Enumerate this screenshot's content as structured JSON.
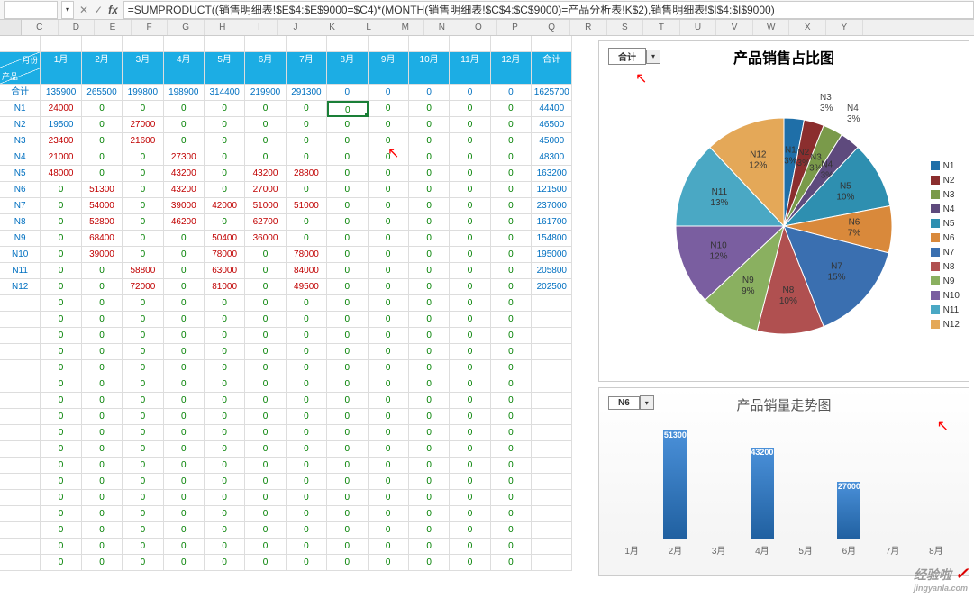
{
  "formula_bar": {
    "name_box": "",
    "fx": "fx",
    "x_icon": "✕",
    "check_icon": "✓",
    "formula": "=SUMPRODUCT((销售明细表!$E$4:$E$9000=$C4)*(MONTH(销售明细表!$C$4:$C$9000)=产品分析表!K$2),销售明细表!$I$4:$I$9000)"
  },
  "columns": [
    "C",
    "D",
    "E",
    "F",
    "G",
    "H",
    "I",
    "J",
    "K",
    "L",
    "M",
    "N",
    "O",
    "P",
    "Q",
    "R",
    "S",
    "T",
    "U",
    "V",
    "W",
    "X",
    "Y"
  ],
  "table_header": {
    "corner_top": "月份",
    "corner_bottom": "产品",
    "months": [
      "1月",
      "2月",
      "3月",
      "4月",
      "5月",
      "6月",
      "7月",
      "8月",
      "9月",
      "10月",
      "11月",
      "12月",
      "合计"
    ]
  },
  "rows": [
    {
      "label": "合计",
      "cells": [
        135900,
        265500,
        199800,
        198900,
        314400,
        219900,
        291300,
        0,
        0,
        0,
        0,
        0,
        1625700
      ]
    },
    {
      "label": "N1",
      "cells": [
        24000,
        0,
        0,
        0,
        0,
        0,
        0,
        0,
        0,
        0,
        0,
        0,
        44400
      ]
    },
    {
      "label": "N2",
      "cells": [
        19500,
        0,
        27000,
        0,
        0,
        0,
        0,
        0,
        0,
        0,
        0,
        0,
        46500
      ]
    },
    {
      "label": "N3",
      "cells": [
        23400,
        0,
        21600,
        0,
        0,
        0,
        0,
        0,
        0,
        0,
        0,
        0,
        45000
      ]
    },
    {
      "label": "N4",
      "cells": [
        21000,
        0,
        0,
        27300,
        0,
        0,
        0,
        0,
        0,
        0,
        0,
        0,
        48300
      ]
    },
    {
      "label": "N5",
      "cells": [
        48000,
        0,
        0,
        43200,
        0,
        43200,
        28800,
        0,
        0,
        0,
        0,
        0,
        163200
      ]
    },
    {
      "label": "N6",
      "cells": [
        0,
        51300,
        0,
        43200,
        0,
        27000,
        0,
        0,
        0,
        0,
        0,
        0,
        121500
      ]
    },
    {
      "label": "N7",
      "cells": [
        0,
        54000,
        0,
        39000,
        42000,
        51000,
        51000,
        0,
        0,
        0,
        0,
        0,
        237000
      ]
    },
    {
      "label": "N8",
      "cells": [
        0,
        52800,
        0,
        46200,
        0,
        62700,
        0,
        0,
        0,
        0,
        0,
        0,
        161700
      ]
    },
    {
      "label": "N9",
      "cells": [
        0,
        68400,
        0,
        0,
        50400,
        36000,
        0,
        0,
        0,
        0,
        0,
        0,
        154800
      ]
    },
    {
      "label": "N10",
      "cells": [
        0,
        39000,
        0,
        0,
        78000,
        0,
        78000,
        0,
        0,
        0,
        0,
        0,
        195000
      ]
    },
    {
      "label": "N11",
      "cells": [
        0,
        0,
        58800,
        0,
        63000,
        0,
        84000,
        0,
        0,
        0,
        0,
        0,
        205800
      ]
    },
    {
      "label": "N12",
      "cells": [
        0,
        0,
        72000,
        0,
        81000,
        0,
        49500,
        0,
        0,
        0,
        0,
        0,
        202500
      ]
    }
  ],
  "empty_rows": 17,
  "red_threshold": 20000,
  "selected_cell": {
    "row": 1,
    "col": 7
  },
  "pie": {
    "dropdown_label": "合计",
    "title": "产品销售占比图",
    "slices": [
      {
        "name": "N1",
        "pct": 3,
        "color": "#1f6fa8"
      },
      {
        "name": "N2",
        "pct": 3,
        "color": "#8b2e2e"
      },
      {
        "name": "N3",
        "pct": 3,
        "color": "#7a9a4a"
      },
      {
        "name": "N4",
        "pct": 3,
        "color": "#5e4a7d"
      },
      {
        "name": "N5",
        "pct": 10,
        "color": "#2e8fb0"
      },
      {
        "name": "N6",
        "pct": 7,
        "color": "#d9893b"
      },
      {
        "name": "N7",
        "pct": 15,
        "color": "#3a6fb0"
      },
      {
        "name": "N8",
        "pct": 10,
        "color": "#b05050"
      },
      {
        "name": "N9",
        "pct": 9,
        "color": "#8ab060"
      },
      {
        "name": "N10",
        "pct": 12,
        "color": "#7a5ea0"
      },
      {
        "name": "N11",
        "pct": 13,
        "color": "#4aa8c4"
      },
      {
        "name": "N12",
        "pct": 12,
        "color": "#e4a858"
      }
    ]
  },
  "bar": {
    "title": "产品销量走势图",
    "dropdown_label": "N6",
    "x": [
      "1月",
      "2月",
      "3月",
      "4月",
      "5月",
      "6月",
      "7月",
      "8月"
    ],
    "values": [
      0,
      51300,
      0,
      43200,
      0,
      27000,
      0,
      0
    ],
    "max": 55000
  },
  "watermark": {
    "text": "经验啦",
    "url": "jingyanla.com",
    "check": "✓"
  },
  "chart_data": [
    {
      "type": "pie",
      "title": "产品销售占比图",
      "series": [
        {
          "name": "合计",
          "values": [
            3,
            3,
            3,
            3,
            10,
            7,
            15,
            10,
            9,
            12,
            13,
            12
          ]
        }
      ],
      "categories": [
        "N1",
        "N2",
        "N3",
        "N4",
        "N5",
        "N6",
        "N7",
        "N8",
        "N9",
        "N10",
        "N11",
        "N12"
      ]
    },
    {
      "type": "bar",
      "title": "产品销量走势图",
      "categories": [
        "1月",
        "2月",
        "3月",
        "4月",
        "5月",
        "6月",
        "7月",
        "8月"
      ],
      "values": [
        0,
        51300,
        0,
        43200,
        0,
        27000,
        0,
        0
      ],
      "series_name": "N6"
    }
  ]
}
